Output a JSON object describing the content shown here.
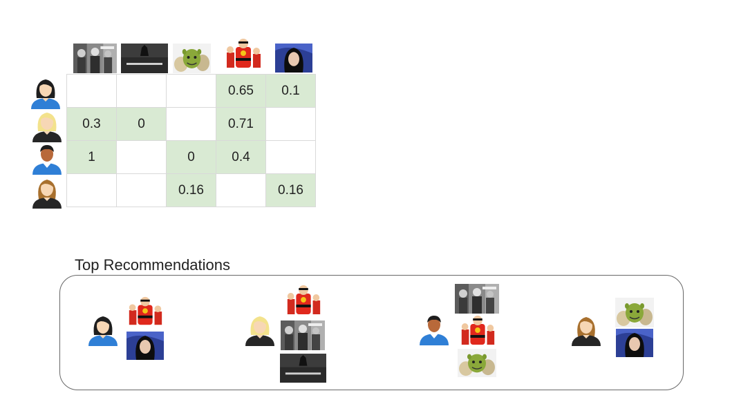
{
  "movies": [
    {
      "id": "m1",
      "icon": "dark-action-poster-icon",
      "bg": "#8a8a8a"
    },
    {
      "id": "m2",
      "icon": "dark-knight-poster-icon",
      "bg": "#2a2a2a"
    },
    {
      "id": "m3",
      "icon": "ogre-poster-icon",
      "bg": "#f2f2f2"
    },
    {
      "id": "m4",
      "icon": "superhero-family-poster-icon",
      "bg": "#ffffff"
    },
    {
      "id": "m5",
      "icon": "woman-portrait-poster-icon",
      "bg": "#2c3f95"
    }
  ],
  "users": [
    {
      "id": "u1",
      "icon": "woman-dark-hair-avatar-icon",
      "hair": "#1e1e1e",
      "skin": "#f7d7b5",
      "shirt": "#2f7fd6"
    },
    {
      "id": "u2",
      "icon": "woman-blonde-hair-avatar-icon",
      "hair": "#f3e28c",
      "skin": "#f7d7b5",
      "shirt": "#262626"
    },
    {
      "id": "u3",
      "icon": "man-short-hair-avatar-icon",
      "hair": "#1e1e1e",
      "skin": "#b8693a",
      "shirt": "#2f7fd6"
    },
    {
      "id": "u4",
      "icon": "woman-brown-hair-avatar-icon",
      "hair": "#a8702e",
      "skin": "#f7d7b5",
      "shirt": "#262626"
    }
  ],
  "matrix": {
    "rows": [
      [
        "",
        "",
        "",
        "0.65",
        "0.1"
      ],
      [
        "0.3",
        "0",
        "",
        "0.71",
        ""
      ],
      [
        "1",
        "",
        "0",
        "0.4",
        ""
      ],
      [
        "",
        "",
        "0.16",
        "",
        "0.16"
      ]
    ],
    "filled_color": "#d9ead3",
    "border_color": "#d9d9d9"
  },
  "recommendations": {
    "title": "Top Recommendations",
    "groups": [
      {
        "user": "u1",
        "movies": [
          "m4",
          "m5"
        ]
      },
      {
        "user": "u2",
        "movies": [
          "m4",
          "m1",
          "m2"
        ]
      },
      {
        "user": "u3",
        "movies": [
          "m1",
          "m4",
          "m3"
        ]
      },
      {
        "user": "u4",
        "movies": [
          "m3",
          "m5"
        ]
      }
    ]
  }
}
